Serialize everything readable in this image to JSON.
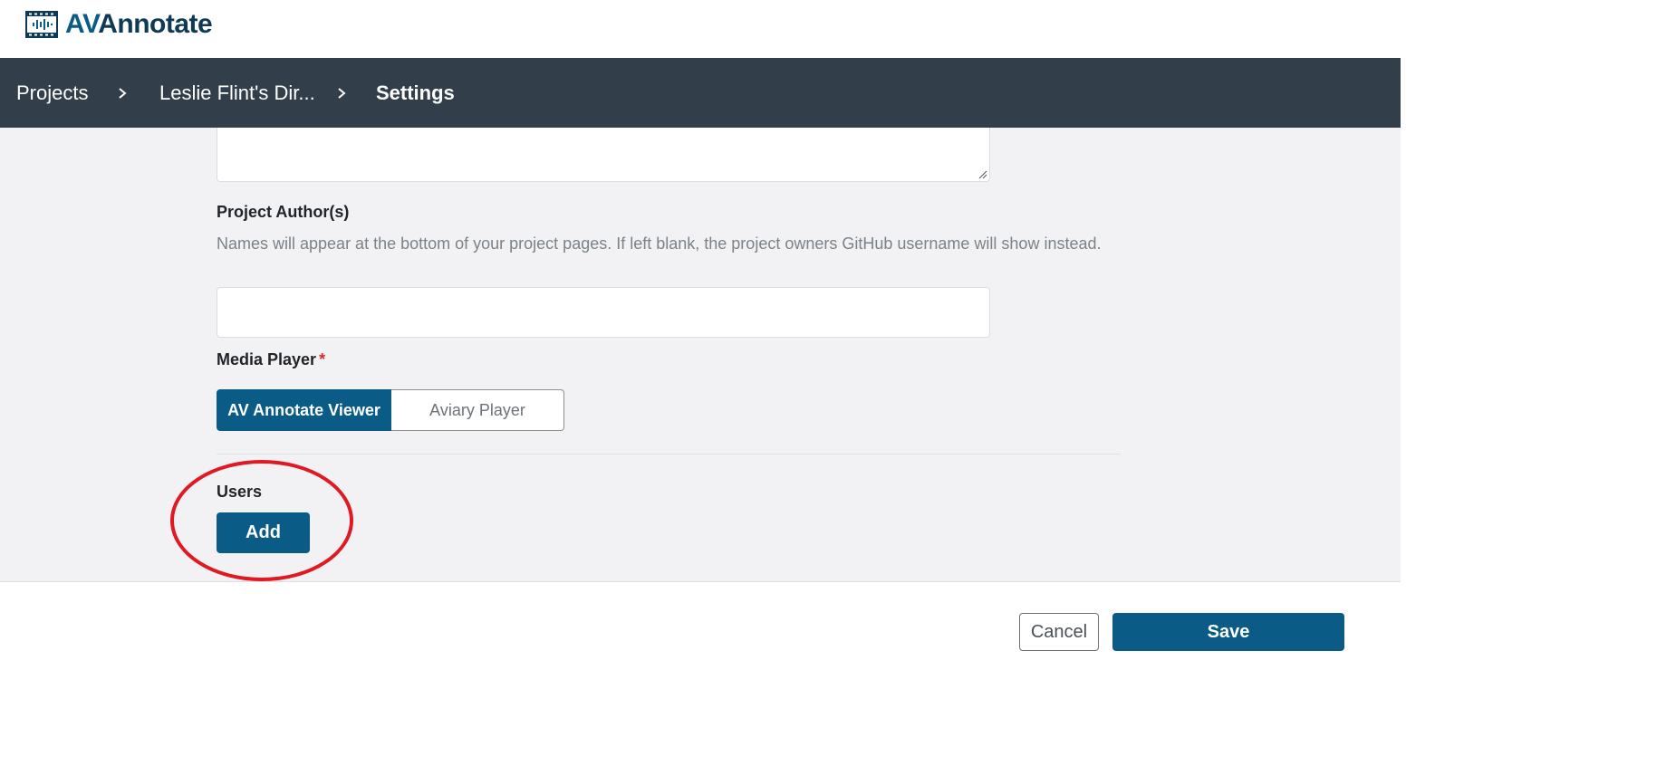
{
  "app": {
    "logo_prefix": "AV",
    "logo_rest": "Annotate",
    "logo_icon": "film-audio-icon",
    "accent_color": "#0a5c86",
    "navbar_color": "#323f4b"
  },
  "breadcrumb": {
    "items": [
      "Projects",
      "Leslie Flint's Dir...",
      "Settings"
    ],
    "separator_icon": "chevron-right-icon"
  },
  "form": {
    "author": {
      "label": "Project Author(s)",
      "help": "Names will appear at the bottom of your project pages. If left blank, the project owners GitHub username will show instead.",
      "value": ""
    },
    "media_player": {
      "label": "Media Player",
      "required_marker": "*",
      "options": [
        "AV Annotate Viewer",
        "Aviary Player"
      ],
      "selected": "AV Annotate Viewer"
    },
    "users": {
      "label": "Users",
      "add_label": "Add"
    }
  },
  "footer": {
    "cancel_label": "Cancel",
    "save_label": "Save"
  },
  "annotation": {
    "highlight_color": "#e01a22"
  }
}
